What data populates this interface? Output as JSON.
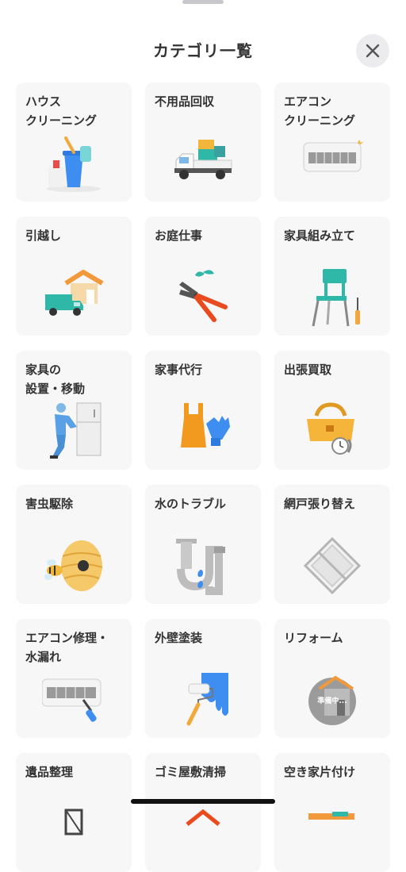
{
  "header": {
    "title": "カテゴリ一覧",
    "close_icon": "close-icon"
  },
  "categories": [
    {
      "label": "ハウス\nクリーニング",
      "icon": "cleaning-bucket-icon"
    },
    {
      "label": "不用品回収",
      "icon": "truck-icon"
    },
    {
      "label": "エアコン\nクリーニング",
      "icon": "air-conditioner-icon"
    },
    {
      "label": "引越し",
      "icon": "moving-house-icon"
    },
    {
      "label": "お庭仕事",
      "icon": "pruning-shears-icon"
    },
    {
      "label": "家具組み立て",
      "icon": "chair-screwdriver-icon"
    },
    {
      "label": "家具の\n設置・移動",
      "icon": "worker-fridge-icon"
    },
    {
      "label": "家事代行",
      "icon": "apron-gloves-icon"
    },
    {
      "label": "出張買取",
      "icon": "bag-watch-icon"
    },
    {
      "label": "害虫駆除",
      "icon": "bee-nest-icon"
    },
    {
      "label": "水のトラブル",
      "icon": "pipe-water-icon"
    },
    {
      "label": "網戸張り替え",
      "icon": "window-screen-icon"
    },
    {
      "label": "エアコン修理・\n水漏れ",
      "icon": "ac-repair-icon"
    },
    {
      "label": "外壁塗装",
      "icon": "paint-roller-icon"
    },
    {
      "label": "リフォーム",
      "icon": "house-renovation-icon",
      "badge": "準備中..."
    },
    {
      "label": "遺品整理",
      "icon": "belongings-icon"
    },
    {
      "label": "ゴミ屋敷清掃",
      "icon": "trash-house-icon"
    },
    {
      "label": "空き家片付け",
      "icon": "empty-house-icon"
    }
  ]
}
